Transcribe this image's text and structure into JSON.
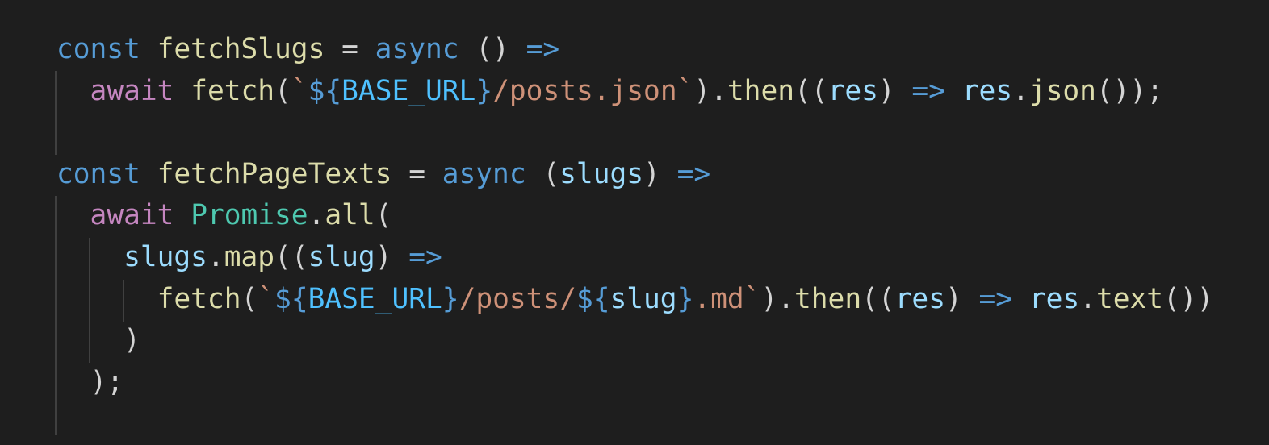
{
  "editor": {
    "language": "javascript",
    "theme_colors": {
      "background": "#1e1e1e",
      "keyword_storage": "#569cd6",
      "keyword_control": "#c586c0",
      "function": "#dcdcaa",
      "variable": "#9cdcfe",
      "constant": "#4fc1ff",
      "string": "#ce9178",
      "class": "#4ec9b0",
      "punctuation": "#d4d4d4",
      "indent_guide": "#404040"
    },
    "lines": [
      [
        {
          "t": "const",
          "c": "kw-blue"
        },
        {
          "t": " ",
          "c": "punc"
        },
        {
          "t": "fetchSlugs",
          "c": "fn"
        },
        {
          "t": " = ",
          "c": "punc"
        },
        {
          "t": "async",
          "c": "kw-blue"
        },
        {
          "t": " () ",
          "c": "punc"
        },
        {
          "t": "=>",
          "c": "kw-blue"
        }
      ],
      [
        {
          "t": "  ",
          "c": "punc"
        },
        {
          "t": "await",
          "c": "kw-purple"
        },
        {
          "t": " ",
          "c": "punc"
        },
        {
          "t": "fetch",
          "c": "fn"
        },
        {
          "t": "(",
          "c": "punc"
        },
        {
          "t": "`",
          "c": "str"
        },
        {
          "t": "${",
          "c": "tpl"
        },
        {
          "t": "BASE_URL",
          "c": "const"
        },
        {
          "t": "}",
          "c": "tpl"
        },
        {
          "t": "/posts.json`",
          "c": "str"
        },
        {
          "t": ").",
          "c": "punc"
        },
        {
          "t": "then",
          "c": "fn"
        },
        {
          "t": "((",
          "c": "punc"
        },
        {
          "t": "res",
          "c": "var"
        },
        {
          "t": ") ",
          "c": "punc"
        },
        {
          "t": "=>",
          "c": "kw-blue"
        },
        {
          "t": " ",
          "c": "punc"
        },
        {
          "t": "res",
          "c": "var"
        },
        {
          "t": ".",
          "c": "punc"
        },
        {
          "t": "json",
          "c": "fn"
        },
        {
          "t": "());",
          "c": "punc"
        }
      ],
      [],
      [
        {
          "t": "const",
          "c": "kw-blue"
        },
        {
          "t": " ",
          "c": "punc"
        },
        {
          "t": "fetchPageTexts",
          "c": "fn"
        },
        {
          "t": " = ",
          "c": "punc"
        },
        {
          "t": "async",
          "c": "kw-blue"
        },
        {
          "t": " (",
          "c": "punc"
        },
        {
          "t": "slugs",
          "c": "var"
        },
        {
          "t": ") ",
          "c": "punc"
        },
        {
          "t": "=>",
          "c": "kw-blue"
        }
      ],
      [
        {
          "t": "  ",
          "c": "punc"
        },
        {
          "t": "await",
          "c": "kw-purple"
        },
        {
          "t": " ",
          "c": "punc"
        },
        {
          "t": "Promise",
          "c": "type"
        },
        {
          "t": ".",
          "c": "punc"
        },
        {
          "t": "all",
          "c": "fn"
        },
        {
          "t": "(",
          "c": "punc"
        }
      ],
      [
        {
          "t": "    ",
          "c": "punc"
        },
        {
          "t": "slugs",
          "c": "var"
        },
        {
          "t": ".",
          "c": "punc"
        },
        {
          "t": "map",
          "c": "fn"
        },
        {
          "t": "((",
          "c": "punc"
        },
        {
          "t": "slug",
          "c": "var"
        },
        {
          "t": ") ",
          "c": "punc"
        },
        {
          "t": "=>",
          "c": "kw-blue"
        }
      ],
      [
        {
          "t": "      ",
          "c": "punc"
        },
        {
          "t": "fetch",
          "c": "fn"
        },
        {
          "t": "(",
          "c": "punc"
        },
        {
          "t": "`",
          "c": "str"
        },
        {
          "t": "${",
          "c": "tpl"
        },
        {
          "t": "BASE_URL",
          "c": "const"
        },
        {
          "t": "}",
          "c": "tpl"
        },
        {
          "t": "/posts/",
          "c": "str"
        },
        {
          "t": "${",
          "c": "tpl"
        },
        {
          "t": "slug",
          "c": "var"
        },
        {
          "t": "}",
          "c": "tpl"
        },
        {
          "t": ".md`",
          "c": "str"
        },
        {
          "t": ").",
          "c": "punc"
        },
        {
          "t": "then",
          "c": "fn"
        },
        {
          "t": "((",
          "c": "punc"
        },
        {
          "t": "res",
          "c": "var"
        },
        {
          "t": ") ",
          "c": "punc"
        },
        {
          "t": "=>",
          "c": "kw-blue"
        },
        {
          "t": " ",
          "c": "punc"
        },
        {
          "t": "res",
          "c": "var"
        },
        {
          "t": ".",
          "c": "punc"
        },
        {
          "t": "text",
          "c": "fn"
        },
        {
          "t": "())",
          "c": "punc"
        }
      ],
      [
        {
          "t": "    )",
          "c": "punc"
        }
      ],
      [
        {
          "t": "  );",
          "c": "punc"
        }
      ],
      []
    ]
  }
}
